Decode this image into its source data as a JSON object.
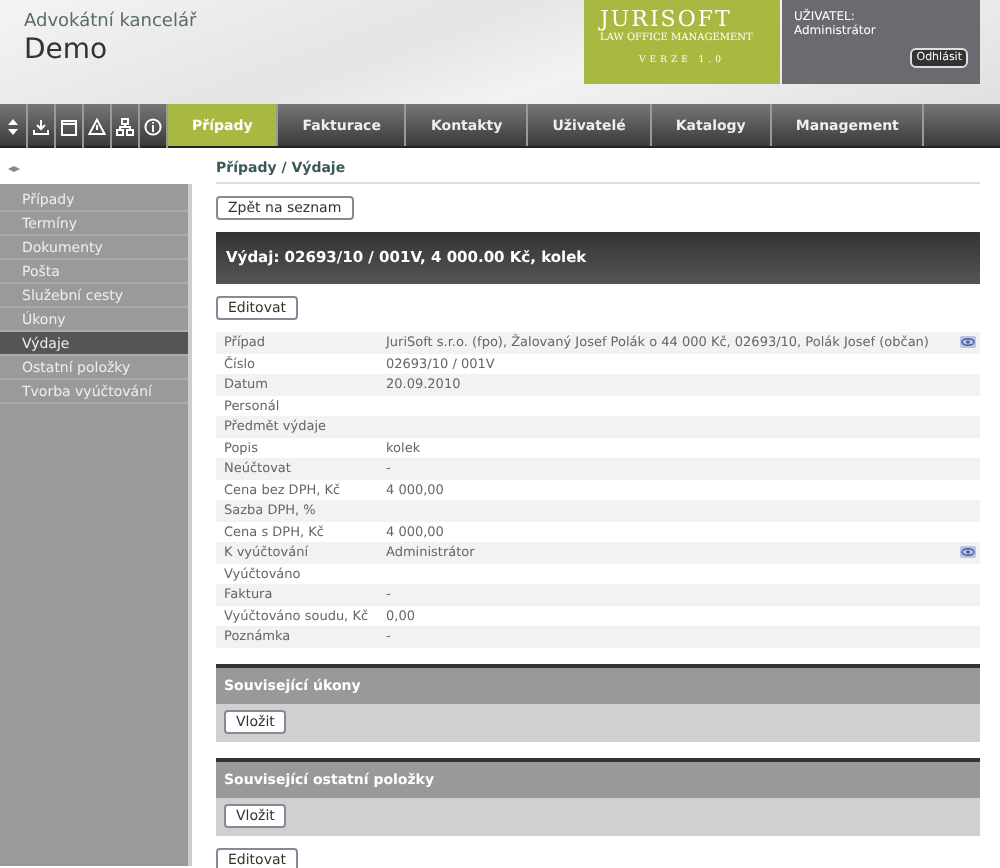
{
  "header": {
    "office": "Advokátní kancelář",
    "name": "Demo",
    "brand": "JURISOFT",
    "tagline": "LAW OFFICE MANAGEMENT",
    "version": "VERZE 1.0",
    "user_label": "UŽIVATEL:",
    "user": "Administrátor",
    "logout": "Odhlásit"
  },
  "toolbar_icons": [
    {
      "kind": "updown"
    },
    {
      "kind": "download"
    },
    {
      "kind": "calendar"
    },
    {
      "kind": "warning"
    },
    {
      "kind": "sitemap"
    },
    {
      "kind": "info"
    }
  ],
  "tabs": [
    {
      "label": "Případy",
      "selected": true
    },
    {
      "label": "Fakturace",
      "selected": false
    },
    {
      "label": "Kontakty",
      "selected": false
    },
    {
      "label": "Uživatelé",
      "selected": false
    },
    {
      "label": "Katalogy",
      "selected": false
    },
    {
      "label": "Management",
      "selected": false
    }
  ],
  "sidebar": {
    "toggle": "◂▸",
    "items": [
      {
        "label": "Případy",
        "selected": false
      },
      {
        "label": "Termíny",
        "selected": false
      },
      {
        "label": "Dokumenty",
        "selected": false
      },
      {
        "label": "Pošta",
        "selected": false
      },
      {
        "label": "Služební cesty",
        "selected": false
      },
      {
        "label": "Úkony",
        "selected": false
      },
      {
        "label": "Výdaje",
        "selected": true
      },
      {
        "label": "Ostatní položky",
        "selected": false
      },
      {
        "label": "Tvorba vyúčtování",
        "selected": false
      }
    ]
  },
  "breadcrumb": "Případy / Výdaje",
  "back_button": "Zpět na seznam",
  "title": "Výdaj: 02693/10 / 001V, 4 000.00 Kč, kolek",
  "edit_button": "Editovat",
  "fields": [
    {
      "label": "Případ",
      "value": "JuriSoft s.r.o. (fpo), Žalovaný Josef Polák o 44 000 Kč, 02693/10, Polák Josef (občan)",
      "action_icon": true
    },
    {
      "label": "Číslo",
      "value": "02693/10 / 001V",
      "action_icon": false
    },
    {
      "label": "Datum",
      "value": "20.09.2010",
      "action_icon": false
    },
    {
      "label": "Personál",
      "action_icon": false
    },
    {
      "label": "Předmět výdaje",
      "action_icon": false
    },
    {
      "label": "Popis",
      "value": "kolek",
      "action_icon": false
    },
    {
      "label": "Neúčtovat",
      "value": "-",
      "action_icon": false
    },
    {
      "label": "Cena bez DPH, Kč",
      "value": "4 000,00",
      "action_icon": false
    },
    {
      "label": "Sazba DPH, %",
      "action_icon": false
    },
    {
      "label": "Cena s DPH, Kč",
      "value": "4 000,00",
      "action_icon": false
    },
    {
      "label": "K vyúčtování",
      "value": "Administrátor",
      "action_icon": true
    },
    {
      "label": "Vyúčtováno",
      "action_icon": false
    },
    {
      "label": "Faktura",
      "value": "-",
      "action_icon": false
    },
    {
      "label": "Vyúčtováno soudu, Kč",
      "value": "0,00",
      "action_icon": false
    },
    {
      "label": "Poznámka",
      "value": "-",
      "action_icon": false
    }
  ],
  "sections": [
    {
      "title": "Související úkony",
      "button": "Vložit"
    },
    {
      "title": "Související ostatní položky",
      "button": "Vložit"
    }
  ],
  "bottom_button": "Editovat"
}
